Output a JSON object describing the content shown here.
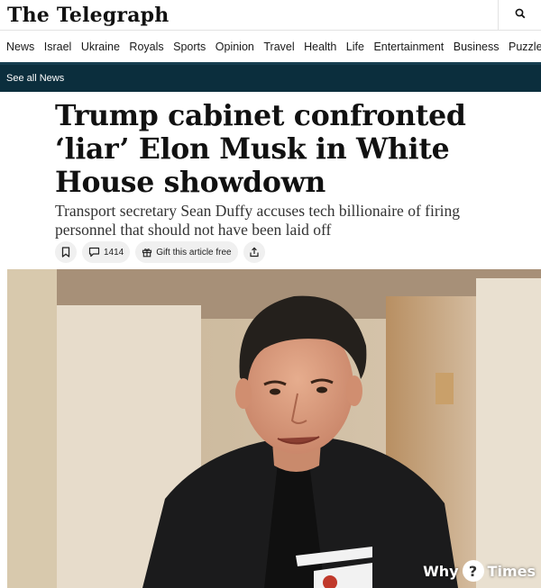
{
  "header": {
    "logo_text": "The Telegraph",
    "search_icon": "search-icon"
  },
  "nav": {
    "items": [
      "News",
      "Israel",
      "Ukraine",
      "Royals",
      "Sports",
      "Opinion",
      "Travel",
      "Health",
      "Life",
      "Entertainment",
      "Business",
      "Puzzles"
    ]
  },
  "subnav": {
    "link_label": "See all News",
    "background": "#0b2e3d"
  },
  "article": {
    "headline": "Trump cabinet confronted ‘liar’ Elon Musk in White House showdown",
    "standfirst": "Transport secretary Sean Duffy accuses tech billionaire of firing personnel that should not have been laid off",
    "actions": {
      "bookmark_icon": "bookmark-icon",
      "comment_icon": "comment-icon",
      "comment_count": "1414",
      "gift_icon": "gift-icon",
      "gift_label": "Gift this article free",
      "share_icon": "share-icon"
    }
  },
  "watermark": {
    "left": "Why",
    "mark": "?",
    "right": "Times"
  }
}
